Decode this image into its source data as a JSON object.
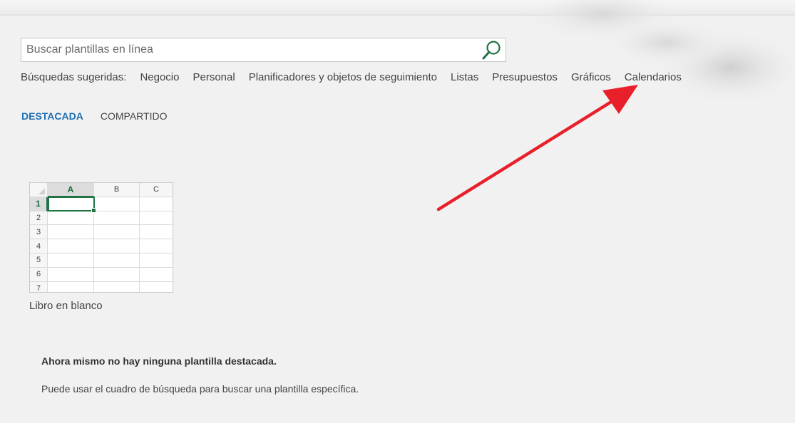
{
  "search": {
    "placeholder": "Buscar plantillas en línea",
    "value": ""
  },
  "suggestions": {
    "label": "Búsquedas sugeridas:",
    "items": [
      "Negocio",
      "Personal",
      "Planificadores y objetos de seguimiento",
      "Listas",
      "Presupuestos",
      "Gráficos",
      "Calendarios"
    ]
  },
  "tabs": [
    {
      "label": "DESTACADA",
      "active": true
    },
    {
      "label": "COMPARTIDO",
      "active": false
    }
  ],
  "template": {
    "label": "Libro en blanco",
    "columns": [
      "A",
      "B",
      "C"
    ],
    "rows": [
      "1",
      "2",
      "3",
      "4",
      "5",
      "6",
      "7"
    ],
    "selected_cell": "A1"
  },
  "message": {
    "title": "Ahora mismo no hay ninguna plantilla destacada.",
    "body": "Puede usar el cuadro de búsqueda para buscar una plantilla específica."
  },
  "colors": {
    "accent": "#1e6fb3",
    "excel_green": "#217346",
    "annotation_arrow": "#e8202a"
  },
  "icons": {
    "search": "search-icon"
  }
}
